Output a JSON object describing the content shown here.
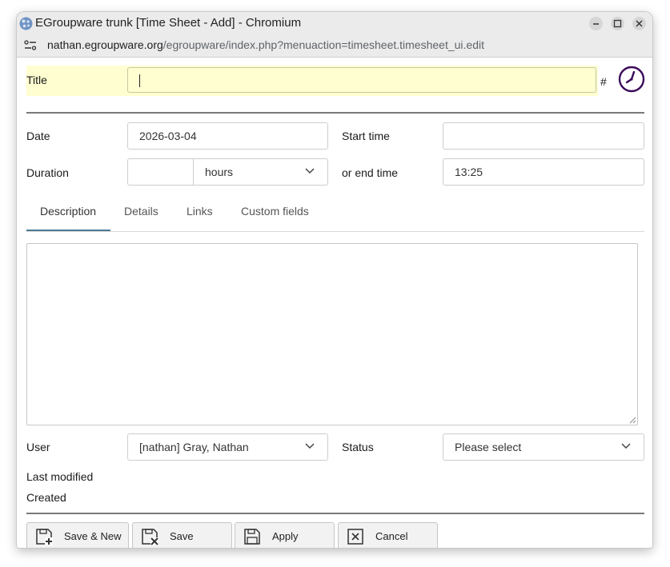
{
  "window": {
    "title": "EGroupware trunk [Time Sheet - Add] - Chromium",
    "controls": [
      "minimize-icon",
      "maximize-icon",
      "close-icon"
    ]
  },
  "address_bar": {
    "host": "nathan.egroupware.org",
    "path": "/egroupware/index.php?menuaction=timesheet.timesheet_ui.edit"
  },
  "form": {
    "title_label": "Title",
    "title_value": "",
    "hash": "#",
    "date_label": "Date",
    "date_value": "2026-03-04",
    "start_time_label": "Start time",
    "start_time_value": "",
    "duration_label": "Duration",
    "duration_value": "",
    "duration_unit": "hours",
    "end_time_label": "or end time",
    "end_time_value": "13:25",
    "description_value": "",
    "user_label": "User",
    "user_value": "[nathan] Gray, Nathan",
    "status_label": "Status",
    "status_value": "Please select",
    "last_modified_label": "Last modified",
    "created_label": "Created"
  },
  "tabs": [
    {
      "label": "Description",
      "active": true
    },
    {
      "label": "Details",
      "active": false
    },
    {
      "label": "Links",
      "active": false
    },
    {
      "label": "Custom fields",
      "active": false
    }
  ],
  "buttons": {
    "save_new": "Save & New",
    "save": "Save",
    "apply": "Apply",
    "cancel": "Cancel"
  },
  "colors": {
    "title_highlight": "#fefed0",
    "accent": "#3b0a5a",
    "tab_underline": "#4e7a94"
  }
}
